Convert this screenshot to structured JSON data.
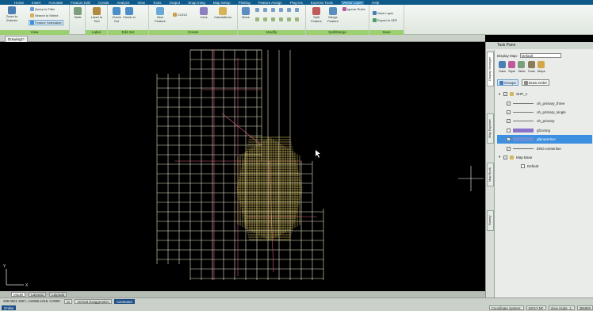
{
  "app": {
    "tabs": [
      "Home",
      "Insert",
      "Annotate",
      "Feature Edit",
      "Create",
      "Analyze",
      "View",
      "Tools",
      "Output",
      "Snap Integ",
      "Map Setup",
      "Plotting",
      "Feature Assign",
      "Plug-ins",
      "Express Tools",
      "Vector Layer",
      "Help"
    ],
    "active_tab_index": 15,
    "accent": "#0e5a8a",
    "ribbon_title_color": "#9bcf6f"
  },
  "ribbon": {
    "view_panel": {
      "title": "View",
      "zoom_to_extents": "Zoom to Extents",
      "query_to_filter": "Query to Filter",
      "search_to_select": "Search to Select",
      "feature_selectable": "Feature Selectable"
    },
    "table": {
      "label": "Table"
    },
    "label_feature": {
      "title": "Label Feature",
      "label_to_text": "Label to Text"
    },
    "edit_set": {
      "title": "Edit Set",
      "check_out": "Check Out",
      "check_in": "Check In"
    },
    "create": {
      "title": "Create",
      "new_feature": "New Feature",
      "cogo": "COGO",
      "joins": "Joins",
      "calculations": "Calculations"
    },
    "modify": {
      "title": "Modify",
      "move": "Move"
    },
    "split_merge": {
      "title": "Split/Merge",
      "split_feature": "Split Feature",
      "merge_feature": "Merge Feature",
      "ignore_rules": "Ignore Rules"
    },
    "save": {
      "title": "Save",
      "save_layer": "Save Layer",
      "export_to_sdf": "Export to SDF"
    }
  },
  "document": {
    "tab": "Drawing1*"
  },
  "layout_tabs": [
    "Model",
    "Layout1",
    "Layout2"
  ],
  "status": {
    "coords": "298.0621 3007, 144956.1219, 0.0000",
    "items": [
      "Vertical Exaggeration",
      "Command"
    ],
    "left_items": [
      "Online"
    ],
    "right_items": [
      "Coordinate System:",
      "NOXY-NF",
      "View Scale: 1:",
      "355983"
    ],
    "zoom_label": "1x"
  },
  "task_pane": {
    "title": "Task Pane",
    "display_map_label": "Display Map:",
    "display_map_value": "Default",
    "tool_icons": [
      "Data",
      "Style",
      "Table",
      "Tools",
      "Maps"
    ],
    "vertical_tabs": [
      "Display Manager",
      "Map Explorer",
      "Map Book",
      "Survey"
    ],
    "groups_button": "Groups",
    "draw_order_button": "Draw Order",
    "layers": [
      {
        "name": "SHP_1",
        "type": "group",
        "checked": true
      },
      {
        "name": "oh_primary_three",
        "type": "line",
        "checked": true,
        "color": "#777777"
      },
      {
        "name": "oh_primary_single",
        "type": "line",
        "checked": true,
        "color": "#777777"
      },
      {
        "name": "oh_primary",
        "type": "line",
        "checked": true,
        "color": "#777777"
      },
      {
        "name": "gfzoning",
        "type": "poly",
        "checked": false,
        "color": "#8a72c9"
      },
      {
        "name": "gfproperties",
        "type": "poly",
        "checked": true,
        "color": "#6b8fd6",
        "selected": true
      },
      {
        "name": "ENG-centerline",
        "type": "line",
        "checked": true,
        "color": "#666666"
      },
      {
        "name": "Map Base",
        "type": "group",
        "checked": true
      },
      {
        "name": "Default",
        "type": "item",
        "checked": false
      }
    ]
  }
}
